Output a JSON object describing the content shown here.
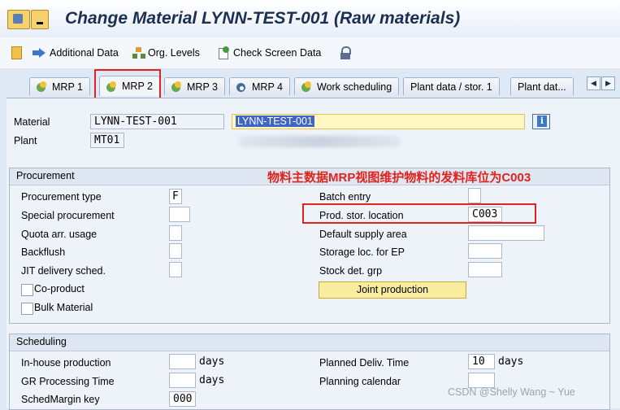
{
  "window": {
    "title": "Change Material LYNN-TEST-001 (Raw materials)"
  },
  "toolbar": {
    "additional_data": "Additional Data",
    "org_levels": "Org. Levels",
    "check_screen_data": "Check Screen Data"
  },
  "tabs": [
    {
      "label": "MRP 1"
    },
    {
      "label": "MRP 2"
    },
    {
      "label": "MRP 3"
    },
    {
      "label": "MRP 4"
    },
    {
      "label": "Work scheduling"
    },
    {
      "label": "Plant data / stor. 1"
    },
    {
      "label": "Plant dat..."
    }
  ],
  "header": {
    "material_label": "Material",
    "material_value": "LYNN-TEST-001",
    "material_desc": "LYNN-TEST-001",
    "plant_label": "Plant",
    "plant_value": "MT01"
  },
  "procurement": {
    "title": "Procurement",
    "annotation": "物料主数据MRP视图维护物料的发料库位为C003",
    "procurement_type_label": "Procurement type",
    "procurement_type_value": "F",
    "special_procurement_label": "Special procurement",
    "quota_label": "Quota arr. usage",
    "backflush_label": "Backflush",
    "jit_label": "JIT delivery sched.",
    "coproduct_label": "Co-product",
    "bulk_label": "Bulk Material",
    "batch_entry_label": "Batch entry",
    "prod_stor_label": "Prod. stor. location",
    "prod_stor_value": "C003",
    "default_supply_label": "Default supply area",
    "storage_ep_label": "Storage loc. for EP",
    "stock_det_label": "Stock det. grp",
    "joint_production": "Joint production"
  },
  "scheduling": {
    "title": "Scheduling",
    "inhouse_label": "In-house production",
    "inhouse_unit": "days",
    "gr_label": "GR Processing Time",
    "gr_unit": "days",
    "schedmargin_label": "SchedMargin key",
    "schedmargin_value": "000",
    "planned_deliv_label": "Planned Deliv. Time",
    "planned_deliv_value": "10",
    "planned_deliv_unit": "days",
    "planning_calendar_label": "Planning calendar"
  },
  "watermark": "CSDN @Shelly Wang ~ Yue"
}
